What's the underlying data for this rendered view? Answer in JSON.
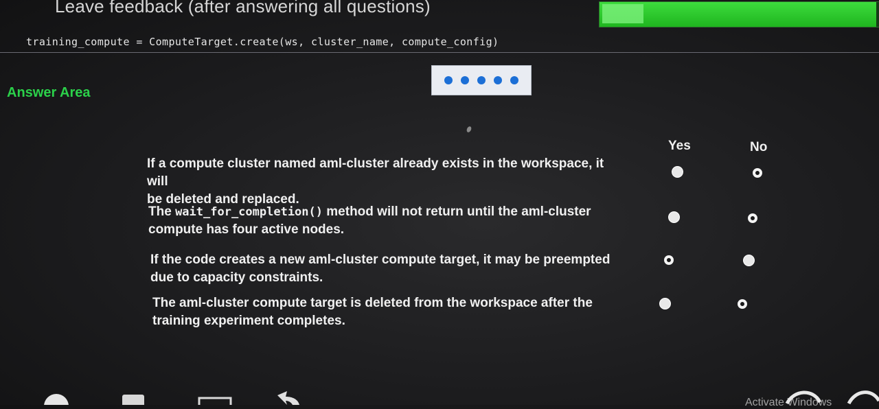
{
  "header": {
    "feedback_label": "Leave feedback (after answering all questions)",
    "progress_fraction": 0.96
  },
  "code": {
    "line": "training_compute = ComputeTarget.create(ws, cluster_name, compute_config)"
  },
  "answer_area": {
    "title": "Answer Area",
    "columns": {
      "yes": "Yes",
      "no": "No"
    },
    "statements": [
      {
        "line1": "If a compute cluster named aml-cluster already exists in the workspace, it will",
        "line2": "be deleted and replaced.",
        "selected": "yes"
      },
      {
        "prefix": "The ",
        "code": "wait_for_completion()",
        "suffix": " method will not return until the aml-cluster",
        "line2": "compute has four active nodes.",
        "selected": "yes"
      },
      {
        "line1": "If the code creates a new aml-cluster compute target, it may be preempted",
        "line2": "due to capacity constraints.",
        "selected": "no"
      },
      {
        "line1": "The aml-cluster compute target is deleted from the workspace after the",
        "line2": "training experiment completes.",
        "selected": "yes"
      }
    ]
  },
  "watermark": "Activate Windows",
  "colors": {
    "accent_green": "#2bd14a",
    "progress_green": "#1fb51f",
    "dots_blue": "#1c6fd6"
  }
}
